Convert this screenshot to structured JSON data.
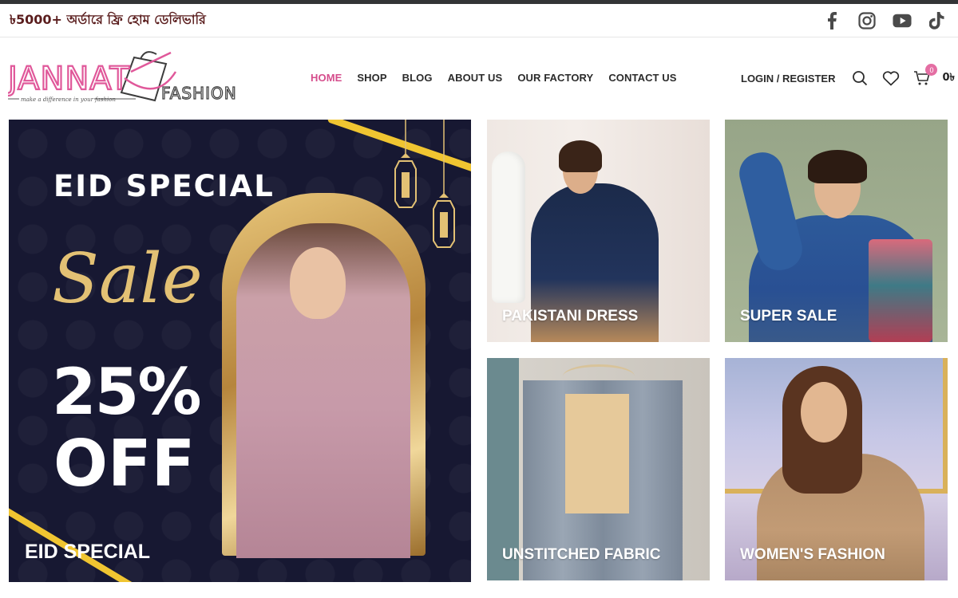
{
  "topbar": {
    "promo": "৳5000+ অর্ডারে ফ্রি হোম ডেলিভারি",
    "socials": [
      {
        "icon": "facebook-icon"
      },
      {
        "icon": "instagram-icon"
      },
      {
        "icon": "youtube-icon"
      },
      {
        "icon": "tiktok-icon"
      }
    ]
  },
  "header": {
    "logo": {
      "wordmark": "JANNAT FASHION",
      "tagline": "make a difference in your fashion"
    },
    "nav": [
      {
        "label": "HOME",
        "active": true
      },
      {
        "label": "SHOP",
        "active": false
      },
      {
        "label": "BLOG",
        "active": false
      },
      {
        "label": "ABOUT US",
        "active": false
      },
      {
        "label": "OUR FACTORY",
        "active": false
      },
      {
        "label": "CONTACT US",
        "active": false
      }
    ],
    "login_label": "LOGIN / REGISTER",
    "cart_count": "0",
    "cart_total": "0৳",
    "accent_color": "#d54d8c"
  },
  "hero": {
    "heading": "EID SPECIAL",
    "script": "Sale",
    "discount": "25%",
    "off": "OFF",
    "caption": "EID SPECIAL",
    "bg_color": "#171832",
    "gold_color": "#f0c531"
  },
  "tiles": [
    {
      "caption": "PAKISTANI DRESS"
    },
    {
      "caption": "SUPER SALE"
    },
    {
      "caption": "UNSTITCHED FABRIC"
    },
    {
      "caption": "WOMEN'S FASHION"
    }
  ]
}
